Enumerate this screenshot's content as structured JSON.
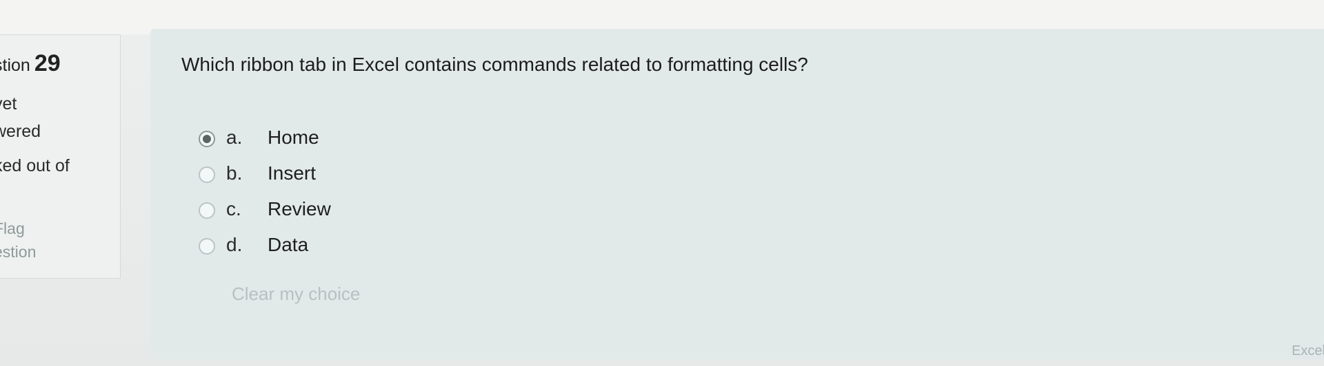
{
  "sidebar": {
    "question_label": "stion",
    "question_number": "29",
    "status_line1": "yet",
    "status_line2": "wered",
    "marks_line": "ked out of",
    "marks_value": ")",
    "flag_line1": "Flag",
    "flag_line2": "estion"
  },
  "question": {
    "text": "Which ribbon tab in Excel contains commands related to formatting cells?",
    "answers": [
      {
        "letter": "a.",
        "text": "Home",
        "selected": true
      },
      {
        "letter": "b.",
        "text": "Insert",
        "selected": false
      },
      {
        "letter": "c.",
        "text": "Review",
        "selected": false
      },
      {
        "letter": "d.",
        "text": "Data",
        "selected": false
      }
    ],
    "clear_label": "Clear my choice"
  },
  "footer": {
    "partial_text": "Excel"
  }
}
